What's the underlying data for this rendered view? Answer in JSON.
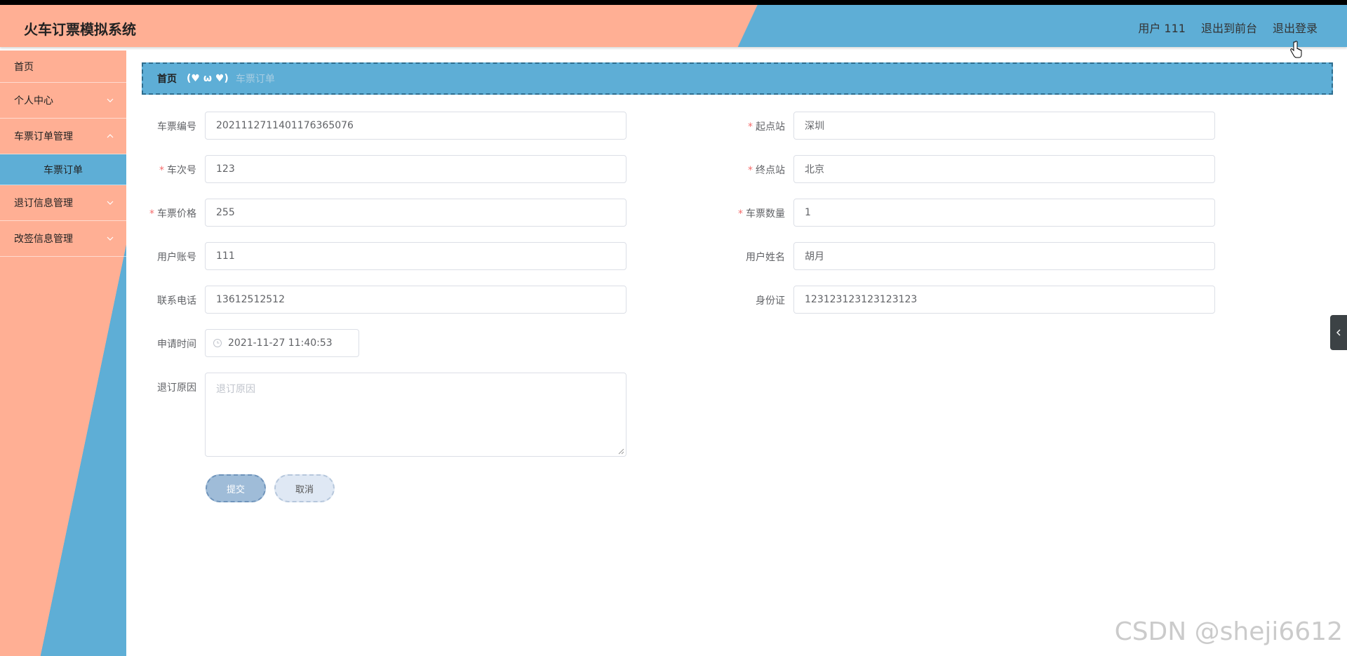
{
  "app": {
    "title": "火车订票模拟系统"
  },
  "header": {
    "user": "用户 111",
    "to_front": "退出到前台",
    "logout": "退出登录"
  },
  "sidebar": {
    "items": [
      {
        "label": "首页"
      },
      {
        "label": "个人中心"
      },
      {
        "label": "车票订单管理"
      },
      {
        "label": "车票订单"
      },
      {
        "label": "退订信息管理"
      },
      {
        "label": "改签信息管理"
      }
    ]
  },
  "breadcrumb": {
    "home": "首页",
    "separator": "(♥ ω ♥)",
    "current": "车票订单"
  },
  "form": {
    "ticket_no": {
      "label": "车票编号",
      "value": "20211127114011763650​76"
    },
    "train_no": {
      "label": "车次号",
      "value": "123"
    },
    "price": {
      "label": "车票价格",
      "value": "255"
    },
    "account": {
      "label": "用户账号",
      "value": "111"
    },
    "phone": {
      "label": "联系电话",
      "value": "13612512512"
    },
    "apply_time": {
      "label": "申请时间",
      "value": "2021-11-27 11:40:53"
    },
    "reason": {
      "label": "退订原因",
      "placeholder": "退订原因"
    },
    "origin": {
      "label": "起点站",
      "value": "深圳"
    },
    "destination": {
      "label": "终点站",
      "value": "北京"
    },
    "quantity": {
      "label": "车票数量",
      "value": "1"
    },
    "name": {
      "label": "用户姓名",
      "value": "胡月"
    },
    "id_card": {
      "label": "身份证",
      "value": "123123123123123123"
    }
  },
  "buttons": {
    "submit": "提交",
    "cancel": "取消"
  },
  "watermark": "CSDN @sheji6612",
  "colors": {
    "salmon": "#ffaf94",
    "blue": "#5eaed6",
    "required": "#f56c6c"
  }
}
